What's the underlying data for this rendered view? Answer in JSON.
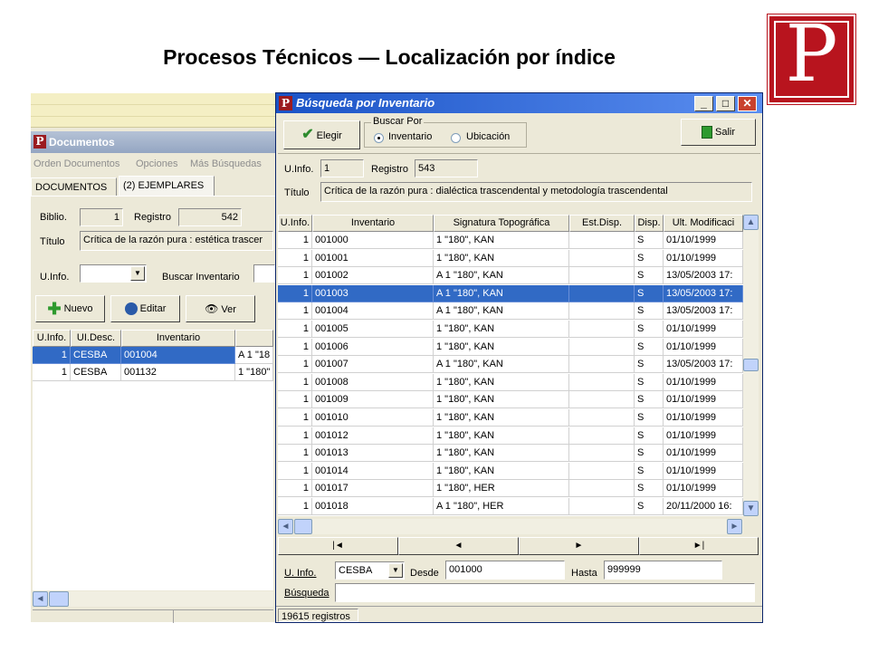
{
  "slide": {
    "title": "Procesos Técnicos — Localización por índice",
    "logo_letter": "P"
  },
  "back_window": {
    "title": "Documentos",
    "menu": [
      "Orden Documentos",
      "Opciones",
      "Más Búsquedas"
    ],
    "tabs": [
      "DOCUMENTOS",
      "(2) EJEMPLARES"
    ],
    "biblio_label": "Biblio.",
    "biblio_value": "1",
    "registro_label": "Registro",
    "registro_value": "542",
    "titulo_label": "Título",
    "titulo_value": "Crítica de la razón pura : estética trascer",
    "uinfo_label": "U.Info.",
    "buscar_label": "Buscar Inventario",
    "buttons": {
      "nuevo": "Nuevo",
      "editar": "Editar",
      "ver": "Ver"
    },
    "columns": [
      "U.Info.",
      "UI.Desc.",
      "Inventario",
      ""
    ],
    "rows": [
      {
        "uinfo": "1",
        "desc": "CESBA",
        "inv": "001004",
        "sig": "A 1 \"18"
      },
      {
        "uinfo": "1",
        "desc": "CESBA",
        "inv": "001132",
        "sig": "1 \"180\""
      }
    ]
  },
  "dialog": {
    "title": "Búsqueda por Inventario",
    "elegir_label": "Elegir",
    "salir_label": "Salir",
    "buscar_por_label": "Buscar Por",
    "radio_inventario": "Inventario",
    "radio_ubicacion": "Ubicación",
    "uinfo_label": "U.Info.",
    "uinfo_value": "1",
    "registro_label": "Registro",
    "registro_value": "543",
    "titulo_label": "Título",
    "titulo_value": "Crítica de la razón pura : dialéctica trascendental y metodología trascendental",
    "columns": [
      "U.Info.",
      "Inventario",
      "Signatura Topográfica",
      "Est.Disp.",
      "Disp.",
      "Ult. Modificaci"
    ],
    "rows": [
      {
        "uinfo": "1",
        "inv": "001000",
        "sig": "1 \"180\", KAN",
        "est": "",
        "disp": "S",
        "mod": "01/10/1999"
      },
      {
        "uinfo": "1",
        "inv": "001001",
        "sig": "1 \"180\", KAN",
        "est": "",
        "disp": "S",
        "mod": "01/10/1999"
      },
      {
        "uinfo": "1",
        "inv": "001002",
        "sig": "A 1 \"180\", KAN",
        "est": "",
        "disp": "S",
        "mod": "13/05/2003 17:"
      },
      {
        "uinfo": "1",
        "inv": "001003",
        "sig": "A 1 \"180\", KAN",
        "est": "",
        "disp": "S",
        "mod": "13/05/2003 17:"
      },
      {
        "uinfo": "1",
        "inv": "001004",
        "sig": "A 1 \"180\", KAN",
        "est": "",
        "disp": "S",
        "mod": "13/05/2003 17:"
      },
      {
        "uinfo": "1",
        "inv": "001005",
        "sig": "1 \"180\", KAN",
        "est": "",
        "disp": "S",
        "mod": "01/10/1999"
      },
      {
        "uinfo": "1",
        "inv": "001006",
        "sig": "1 \"180\", KAN",
        "est": "",
        "disp": "S",
        "mod": "01/10/1999"
      },
      {
        "uinfo": "1",
        "inv": "001007",
        "sig": "A 1 \"180\", KAN",
        "est": "",
        "disp": "S",
        "mod": "13/05/2003 17:"
      },
      {
        "uinfo": "1",
        "inv": "001008",
        "sig": "1 \"180\", KAN",
        "est": "",
        "disp": "S",
        "mod": "01/10/1999"
      },
      {
        "uinfo": "1",
        "inv": "001009",
        "sig": "1 \"180\", KAN",
        "est": "",
        "disp": "S",
        "mod": "01/10/1999"
      },
      {
        "uinfo": "1",
        "inv": "001010",
        "sig": "1 \"180\", KAN",
        "est": "",
        "disp": "S",
        "mod": "01/10/1999"
      },
      {
        "uinfo": "1",
        "inv": "001012",
        "sig": "1 \"180\", KAN",
        "est": "",
        "disp": "S",
        "mod": "01/10/1999"
      },
      {
        "uinfo": "1",
        "inv": "001013",
        "sig": "1 \"180\", KAN",
        "est": "",
        "disp": "S",
        "mod": "01/10/1999"
      },
      {
        "uinfo": "1",
        "inv": "001014",
        "sig": "1 \"180\", KAN",
        "est": "",
        "disp": "S",
        "mod": "01/10/1999"
      },
      {
        "uinfo": "1",
        "inv": "001017",
        "sig": "1 \"180\", HER",
        "est": "",
        "disp": "S",
        "mod": "01/10/1999"
      },
      {
        "uinfo": "1",
        "inv": "001018",
        "sig": "A 1 \"180\", HER",
        "est": "",
        "disp": "S",
        "mod": "20/11/2000 16:"
      }
    ],
    "selected_row": 3,
    "nav": {
      "first": "|◄",
      "prev": "◄",
      "next": "►",
      "last": "►|"
    },
    "uinfo_search_label": "U. Info.",
    "uinfo_search_value": "CESBA",
    "desde_label": "Desde",
    "desde_value": "001000",
    "hasta_label": "Hasta",
    "hasta_value": "999999",
    "busqueda_label": "Búsqueda",
    "busqueda_value": "",
    "status": "19615 registros"
  },
  "colors": {
    "selection": "#316ac5",
    "titlebar": "#1a53c6",
    "logo": "#b8141e"
  }
}
